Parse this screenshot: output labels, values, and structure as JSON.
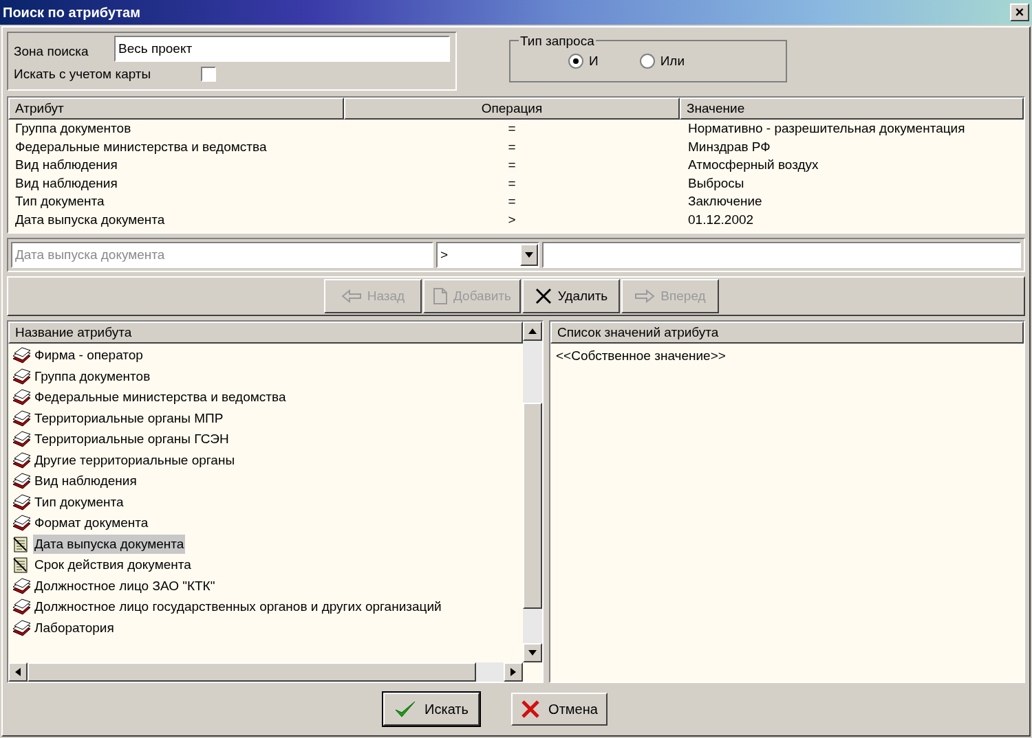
{
  "window": {
    "title": "Поиск по атрибутам",
    "close": "×"
  },
  "search_zone": {
    "label": "Зона поиска",
    "value": "Весь проект"
  },
  "map_option": {
    "label": "Искать с учетом карты",
    "checked": false
  },
  "query_type": {
    "legend": "Тип запроса",
    "options": [
      {
        "label": "И",
        "selected": true
      },
      {
        "label": "Или",
        "selected": false
      }
    ]
  },
  "conditions": {
    "columns": [
      "Атрибут",
      "Операция",
      "Значение"
    ],
    "rows": [
      [
        "Группа документов",
        "=",
        "Нормативно - разрешительная документация"
      ],
      [
        "Федеральные министерства и ведомства",
        "=",
        "Минздрав РФ"
      ],
      [
        "Вид наблюдения",
        "=",
        "Атмосферный воздух"
      ],
      [
        "Вид наблюдения",
        "=",
        "Выбросы"
      ],
      [
        "Тип документа",
        "=",
        "Заключение"
      ],
      [
        "Дата выпуска документа",
        ">",
        "01.12.2002"
      ]
    ]
  },
  "editor": {
    "attribute": "Дата выпуска документа",
    "operation": ">"
  },
  "actions": [
    {
      "kind": "back",
      "label": "Назад",
      "disabled": true
    },
    {
      "kind": "add",
      "label": "Добавить",
      "disabled": true
    },
    {
      "kind": "delete",
      "label": "Удалить",
      "disabled": false
    },
    {
      "kind": "forward",
      "label": "Вперед",
      "disabled": true
    }
  ],
  "attributes": {
    "header": "Название атрибута",
    "items": [
      {
        "label": "Фирма - оператор",
        "kind": "stack",
        "selected": false
      },
      {
        "label": "Группа документов",
        "kind": "stack",
        "selected": false
      },
      {
        "label": "Федеральные министерства и ведомства",
        "kind": "stack",
        "selected": false
      },
      {
        "label": "Территориальные органы МПР",
        "kind": "stack",
        "selected": false
      },
      {
        "label": "Территориальные органы ГСЭН",
        "kind": "stack",
        "selected": false
      },
      {
        "label": "Другие территориальные  органы",
        "kind": "stack",
        "selected": false
      },
      {
        "label": "Вид наблюдения",
        "kind": "stack",
        "selected": false
      },
      {
        "label": "Тип документа",
        "kind": "stack",
        "selected": false
      },
      {
        "label": "Формат документа",
        "kind": "stack",
        "selected": false
      },
      {
        "label": "Дата выпуска документа",
        "kind": "date",
        "selected": true
      },
      {
        "label": "Срок действия документа",
        "kind": "date",
        "selected": false
      },
      {
        "label": "Должностное лицо ЗАО \"КТК\"",
        "kind": "stack",
        "selected": false
      },
      {
        "label": "Должностное лицо государственных органов и других организаций",
        "kind": "stack",
        "selected": false
      },
      {
        "label": "Лаборатория",
        "kind": "stack",
        "selected": false
      }
    ]
  },
  "values": {
    "header": "Список значений атрибута",
    "items": [
      "<<Собственное значение>>"
    ]
  },
  "buttons": [
    {
      "kind": "ok",
      "label": "Искать"
    },
    {
      "kind": "cancel",
      "label": "Отмена"
    }
  ]
}
